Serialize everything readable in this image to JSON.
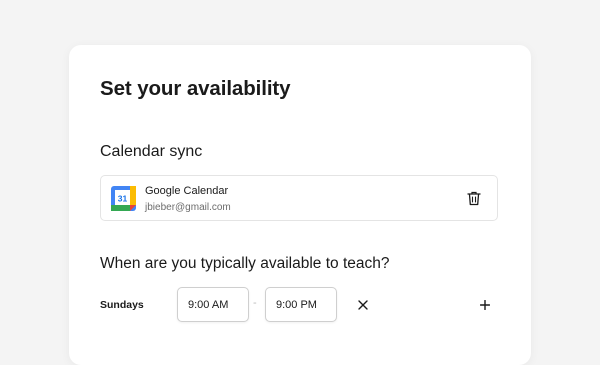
{
  "page": {
    "title": "Set your availability"
  },
  "calendar_sync": {
    "heading": "Calendar sync",
    "icon": "google-calendar-icon",
    "icon_day": "31",
    "provider": "Google Calendar",
    "email": "jbieber@gmail.com",
    "delete_icon": "trash-icon"
  },
  "availability": {
    "question": "When are you typically available to teach?",
    "rows": [
      {
        "day": "Sundays",
        "start": "9:00 AM",
        "end": "9:00 PM",
        "separator": "-",
        "remove_icon": "close-icon",
        "add_icon": "plus-icon"
      }
    ]
  },
  "colors": {
    "background": "#f4f4f4",
    "card": "#ffffff",
    "google_blue": "#4285f4",
    "google_green": "#34a853",
    "google_yellow": "#fbbc04",
    "google_red": "#ea4335"
  }
}
